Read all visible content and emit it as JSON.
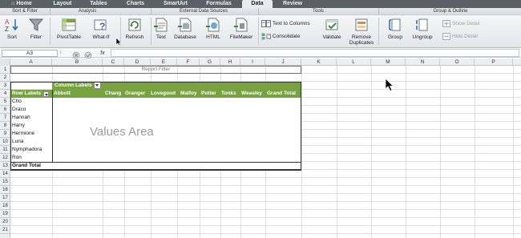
{
  "tabs": [
    {
      "label": "Home",
      "active": false
    },
    {
      "label": "Layout",
      "active": false
    },
    {
      "label": "Tables",
      "active": false
    },
    {
      "label": "Charts",
      "active": false
    },
    {
      "label": "SmartArt",
      "active": false
    },
    {
      "label": "Formulas",
      "active": false
    },
    {
      "label": "Data",
      "active": true
    },
    {
      "label": "Review",
      "active": false
    }
  ],
  "groups": {
    "sort_filter": "Sort & Filter",
    "analysis": "Analysis",
    "external": "External Data Sources",
    "tools": "Tools",
    "group_outline": "Group & Outline"
  },
  "ribbon": {
    "sort": "Sort",
    "filter": "Filter",
    "pivottable": "PivotTable",
    "whatif": "What-If",
    "refresh": "Refresh",
    "text": "Text",
    "database": "Database",
    "html": "HTML",
    "filemaker": "FileMaker",
    "text_to_columns": "Text to Columns",
    "consolidate": "Consolidate",
    "validate": "Validate",
    "remove_duplicates_1": "Remove",
    "remove_duplicates_2": "Duplicates",
    "group": "Group",
    "ungroup": "Ungroup",
    "show_detail": "Show Detail",
    "hide_detail": "Hide Detail"
  },
  "formula_bar": {
    "name_box": "A3",
    "fx": "fx",
    "value": ""
  },
  "columns": [
    "A",
    "B",
    "C",
    "D",
    "E",
    "F",
    "G",
    "H",
    "I",
    "J",
    "K",
    "L",
    "M",
    "N",
    "O",
    "P"
  ],
  "rows": [
    "1",
    "2",
    "3",
    "4",
    "5",
    "6",
    "7",
    "8",
    "9",
    "10",
    "11",
    "12",
    "13",
    "14",
    "15",
    "16",
    "17",
    "18",
    "19",
    "20",
    "21"
  ],
  "pivot": {
    "report_filter": "Report Filter",
    "column_labels": "Column Labels",
    "row_labels": "Row Labels",
    "column_items": [
      "Abbott",
      "Chang",
      "Granger",
      "Lovegood",
      "Malfoy",
      "Potter",
      "Tonks",
      "Weasley",
      "Grand Total"
    ],
    "row_items": [
      "Cho",
      "Draco",
      "Hannah",
      "Harry",
      "Hermione",
      "Luna",
      "Nymphadora",
      "Ron"
    ],
    "grand_total": "Grand Total",
    "values_area": "Values Area",
    "accent_color": "#76a33f"
  }
}
